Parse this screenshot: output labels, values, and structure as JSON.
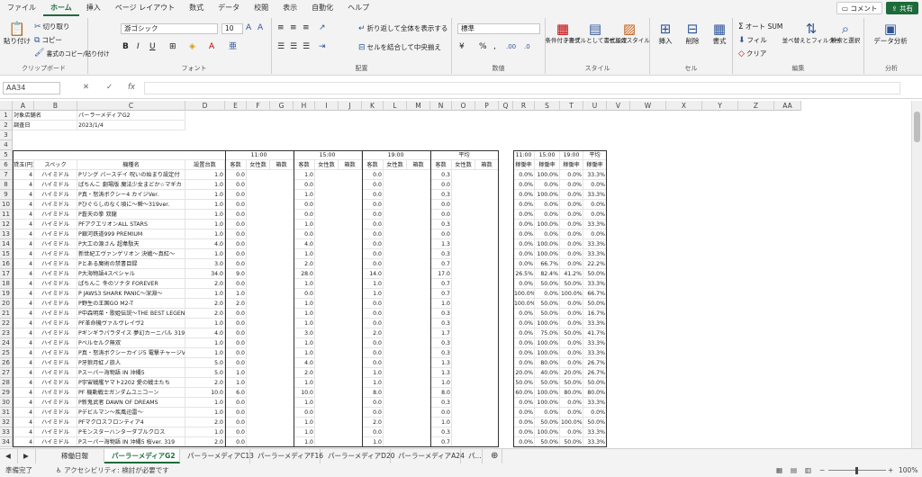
{
  "ribbon_tabs": [
    "ファイル",
    "ホーム",
    "挿入",
    "ページ レイアウト",
    "数式",
    "データ",
    "校閲",
    "表示",
    "自動化",
    "ヘルプ"
  ],
  "active_tab": 1,
  "comment_label": "コメント",
  "share_label": "共有",
  "clipboard": {
    "paste": "貼り付け",
    "cut": "切り取り",
    "copy": "コピー",
    "format": "書式のコピー/貼り付け",
    "label": "クリップボード"
  },
  "font": {
    "name": "游ゴシック",
    "size": "10",
    "label": "フォント"
  },
  "alignment": {
    "wrap": "折り返して全体を表示する",
    "merge": "セルを結合して中央揃え",
    "label": "配置"
  },
  "number": {
    "format": "標準",
    "label": "数値"
  },
  "styles": {
    "cond": "条件付き書式",
    "table": "テーブルとして書式設定",
    "cell": "セルのスタイル",
    "label": "スタイル"
  },
  "cells": {
    "insert": "挿入",
    "delete": "削除",
    "format": "書式",
    "label": "セル"
  },
  "editing": {
    "autosum": "オート SUM",
    "fill": "フィル",
    "clear": "クリア",
    "sort": "並べ替えとフィルター",
    "find": "検索と選択",
    "label": "編集"
  },
  "analysis": {
    "btn": "データ分析",
    "label": "分析"
  },
  "name_box": "AA34",
  "columns": [
    "A",
    "B",
    "C",
    "D",
    "E",
    "F",
    "G",
    "H",
    "I",
    "J",
    "K",
    "L",
    "M",
    "N",
    "O",
    "P",
    "Q",
    "R",
    "S",
    "T",
    "U",
    "V",
    "W",
    "X",
    "Y",
    "Z",
    "AA"
  ],
  "info": {
    "store_label": "対象店舗名",
    "store": "パーラーメディアG2",
    "date_label": "調査日",
    "date": "2023/1/4"
  },
  "group_header": {
    "pachinko": "パチンコ",
    "t11": "11:00",
    "t15": "15:00",
    "t19": "19:00",
    "avg": "平均"
  },
  "headers": {
    "rate": "貸玉(円)",
    "spec": "スペック",
    "model": "機種名",
    "units": "設置台数",
    "guests": "客数",
    "female": "女性数",
    "box": "箱数"
  },
  "summary_headers": {
    "times": [
      "11:00",
      "15:00",
      "19:00",
      "平均"
    ],
    "sub": "稼働率"
  },
  "rows": [
    {
      "r": "4",
      "spec": "ハイミドル",
      "name": "Pリング バースデイ 呪いの始まり設定付",
      "u": "1.0",
      "g11": "0.0",
      "g15": "1.0",
      "g19": "0.0",
      "ga": "0.3",
      "s": [
        "0.0%",
        "100.0%",
        "0.0%",
        "33.3%"
      ]
    },
    {
      "r": "4",
      "spec": "ハイミドル",
      "name": "ぱちんこ 劇場版 魔法少女まどか☆マギカ",
      "u": "1.0",
      "g11": "0.0",
      "g15": "0.0",
      "g19": "0.0",
      "ga": "0.0",
      "s": [
        "0.0%",
        "0.0%",
        "0.0%",
        "0.0%"
      ]
    },
    {
      "r": "4",
      "spec": "ハイミドル",
      "name": "P真・怒涛ボクシー4 カイジVer.",
      "u": "1.0",
      "g11": "0.0",
      "g15": "1.0",
      "g19": "0.0",
      "ga": "0.3",
      "s": [
        "0.0%",
        "100.0%",
        "0.0%",
        "33.3%"
      ]
    },
    {
      "r": "4",
      "spec": "ハイミドル",
      "name": "Pひぐらしのなく頃に～瞬～319ver.",
      "u": "1.0",
      "g11": "0.0",
      "g15": "0.0",
      "g19": "0.0",
      "ga": "0.0",
      "s": [
        "0.0%",
        "0.0%",
        "0.0%",
        "0.0%"
      ]
    },
    {
      "r": "4",
      "spec": "ハイミドル",
      "name": "P蒼天の拳 双龍",
      "u": "1.0",
      "g11": "0.0",
      "g15": "0.0",
      "g19": "0.0",
      "ga": "0.0",
      "s": [
        "0.0%",
        "0.0%",
        "0.0%",
        "0.0%"
      ]
    },
    {
      "r": "4",
      "spec": "ハイミドル",
      "name": "PFアクエリオンALL STARS",
      "u": "1.0",
      "g11": "0.0",
      "g15": "1.0",
      "g19": "0.0",
      "ga": "0.3",
      "s": [
        "0.0%",
        "100.0%",
        "0.0%",
        "33.3%"
      ]
    },
    {
      "r": "4",
      "spec": "ハイミドル",
      "name": "P銀河鉄道999 PREMIUM",
      "u": "1.0",
      "g11": "0.0",
      "g15": "0.0",
      "g19": "0.0",
      "ga": "0.0",
      "s": [
        "0.0%",
        "0.0%",
        "0.0%",
        "0.0%"
      ]
    },
    {
      "r": "4",
      "spec": "ハイミドル",
      "name": "P大工の源さん 超韋駄天",
      "u": "4.0",
      "g11": "0.0",
      "g15": "4.0",
      "g19": "0.0",
      "ga": "1.3",
      "s": [
        "0.0%",
        "100.0%",
        "0.0%",
        "33.3%"
      ]
    },
    {
      "r": "4",
      "spec": "ハイミドル",
      "name": "新世紀エヴァンゲリオン 決戦～真紅～",
      "u": "1.0",
      "g11": "0.0",
      "g15": "1.0",
      "g19": "0.0",
      "ga": "0.3",
      "s": [
        "0.0%",
        "100.0%",
        "0.0%",
        "33.3%"
      ]
    },
    {
      "r": "4",
      "spec": "ハイミドル",
      "name": "Pとある魔術の禁書目録",
      "u": "3.0",
      "g11": "0.0",
      "g15": "2.0",
      "g19": "0.0",
      "ga": "0.7",
      "s": [
        "0.0%",
        "66.7%",
        "0.0%",
        "22.2%"
      ]
    },
    {
      "r": "4",
      "spec": "ハイミドル",
      "name": "P大海物語4スペシャル",
      "u": "34.0",
      "g11": "9.0",
      "g15": "28.0",
      "g19": "14.0",
      "ga": "17.0",
      "s": [
        "26.5%",
        "82.4%",
        "41.2%",
        "50.0%"
      ]
    },
    {
      "r": "4",
      "spec": "ハイミドル",
      "name": "ぱちんこ 冬のソナタ FOREVER",
      "u": "2.0",
      "g11": "0.0",
      "g15": "1.0",
      "g19": "1.0",
      "ga": "0.7",
      "s": [
        "0.0%",
        "50.0%",
        "50.0%",
        "33.3%"
      ]
    },
    {
      "r": "4",
      "spec": "ハイミドル",
      "name": "P JAWS3 SHARK PANIC～深淵～",
      "u": "1.0",
      "g11": "1.0",
      "g15": "0.0",
      "g19": "1.0",
      "ga": "0.7",
      "s": [
        "100.0%",
        "0.0%",
        "100.0%",
        "66.7%"
      ]
    },
    {
      "r": "4",
      "spec": "ハイミドル",
      "name": "P野生の王国GO M2-T",
      "u": "2.0",
      "g11": "2.0",
      "g15": "1.0",
      "g19": "0.0",
      "ga": "1.0",
      "s": [
        "100.0%",
        "50.0%",
        "0.0%",
        "50.0%"
      ]
    },
    {
      "r": "4",
      "spec": "ハイミドル",
      "name": "P中森明菜・歌姫伝説～THE BEST LEGEND～",
      "u": "2.0",
      "g11": "0.0",
      "g15": "1.0",
      "g19": "0.0",
      "ga": "0.3",
      "s": [
        "0.0%",
        "50.0%",
        "0.0%",
        "16.7%"
      ]
    },
    {
      "r": "4",
      "spec": "ハイミドル",
      "name": "PF革命機ヴァルヴレイヴ2",
      "u": "1.0",
      "g11": "0.0",
      "g15": "1.0",
      "g19": "0.0",
      "ga": "0.3",
      "s": [
        "0.0%",
        "100.0%",
        "0.0%",
        "33.3%"
      ]
    },
    {
      "r": "4",
      "spec": "ハイミドル",
      "name": "Pギンギラパラダイス 夢幻カーニバル 319ver.",
      "u": "4.0",
      "g11": "0.0",
      "g15": "3.0",
      "g19": "2.0",
      "ga": "1.7",
      "s": [
        "0.0%",
        "75.0%",
        "50.0%",
        "41.7%"
      ]
    },
    {
      "r": "4",
      "spec": "ハイミドル",
      "name": "Pベルセルク無双",
      "u": "1.0",
      "g11": "0.0",
      "g15": "1.0",
      "g19": "0.0",
      "ga": "0.3",
      "s": [
        "0.0%",
        "100.0%",
        "0.0%",
        "33.3%"
      ]
    },
    {
      "r": "4",
      "spec": "ハイミドル",
      "name": "P真・怒涛ボクシーカイジ5 電撃チャージVer. A",
      "u": "1.0",
      "g11": "0.0",
      "g15": "1.0",
      "g19": "0.0",
      "ga": "0.3",
      "s": [
        "0.0%",
        "100.0%",
        "0.0%",
        "33.3%"
      ]
    },
    {
      "r": "4",
      "spec": "ハイミドル",
      "name": "P牙狼月虹ノ旅人",
      "u": "5.0",
      "g11": "0.0",
      "g15": "4.0",
      "g19": "0.0",
      "ga": "1.3",
      "s": [
        "0.0%",
        "80.0%",
        "0.0%",
        "26.7%"
      ]
    },
    {
      "r": "4",
      "spec": "ハイミドル",
      "name": "Pスーパー海物語 IN 沖縄5",
      "u": "5.0",
      "g11": "1.0",
      "g15": "2.0",
      "g19": "1.0",
      "ga": "1.3",
      "s": [
        "20.0%",
        "40.0%",
        "20.0%",
        "26.7%"
      ]
    },
    {
      "r": "4",
      "spec": "ハイミドル",
      "name": "P宇宙戦艦ヤマト2202 愛の戦士たち",
      "u": "2.0",
      "g11": "1.0",
      "g15": "1.0",
      "g19": "1.0",
      "ga": "1.0",
      "s": [
        "50.0%",
        "50.0%",
        "50.0%",
        "50.0%"
      ]
    },
    {
      "r": "4",
      "spec": "ハイミドル",
      "name": "PF 機動戦士ガンダムユニコーン",
      "u": "10.0",
      "g11": "6.0",
      "g15": "10.0",
      "g19": "8.0",
      "ga": "8.0",
      "s": [
        "60.0%",
        "100.0%",
        "80.0%",
        "80.0%"
      ]
    },
    {
      "r": "4",
      "spec": "ハイミドル",
      "name": "P新鬼武者 DAWN OF DREAMS",
      "u": "1.0",
      "g11": "0.0",
      "g15": "1.0",
      "g19": "0.0",
      "ga": "0.3",
      "s": [
        "0.0%",
        "100.0%",
        "0.0%",
        "33.3%"
      ]
    },
    {
      "r": "4",
      "spec": "ハイミドル",
      "name": "Pデビルマン～疾風迅雷～",
      "u": "1.0",
      "g11": "0.0",
      "g15": "0.0",
      "g19": "0.0",
      "ga": "0.0",
      "s": [
        "0.0%",
        "0.0%",
        "0.0%",
        "0.0%"
      ]
    },
    {
      "r": "4",
      "spec": "ハイミドル",
      "name": "PFマクロスフロンティア4",
      "u": "2.0",
      "g11": "0.0",
      "g15": "1.0",
      "g19": "2.0",
      "ga": "1.0",
      "s": [
        "0.0%",
        "50.0%",
        "100.0%",
        "50.0%"
      ]
    },
    {
      "r": "4",
      "spec": "ハイミドル",
      "name": "Pモンスターハンターダブルクロス",
      "u": "1.0",
      "g11": "0.0",
      "g15": "1.0",
      "g19": "0.0",
      "ga": "0.3",
      "s": [
        "0.0%",
        "100.0%",
        "0.0%",
        "33.3%"
      ]
    },
    {
      "r": "4",
      "spec": "ハイミドル",
      "name": "Pスーパー海物語 IN 沖縄5 桜ver. 319",
      "u": "2.0",
      "g11": "0.0",
      "g15": "1.0",
      "g19": "1.0",
      "ga": "0.7",
      "s": [
        "0.0%",
        "50.0%",
        "50.0%",
        "33.3%"
      ]
    }
  ],
  "sheet_tabs": [
    "稼働日報",
    "パーラーメディアG2",
    "パーラーメディアC13",
    "パーラーメディアF16",
    "パーラーメディアD20",
    "パーラーメディアA24",
    "パ..."
  ],
  "active_sheet": 1,
  "status": {
    "ready": "準備完了",
    "accessibility": "アクセシビリティ: 検討が必要です",
    "zoom": "100%"
  }
}
